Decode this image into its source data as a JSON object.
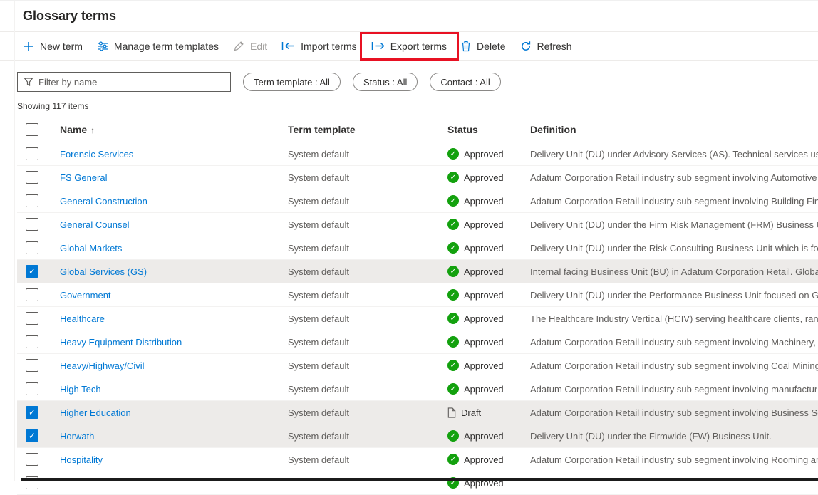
{
  "page": {
    "title": "Glossary terms"
  },
  "toolbar": {
    "items": [
      {
        "label": "New term",
        "icon": "plus-icon",
        "disabled": false,
        "highlighted": false
      },
      {
        "label": "Manage term templates",
        "icon": "sliders-icon",
        "disabled": false,
        "highlighted": false
      },
      {
        "label": "Edit",
        "icon": "pencil-icon",
        "disabled": true,
        "highlighted": false
      },
      {
        "label": "Import terms",
        "icon": "import-arrow-icon",
        "disabled": false,
        "highlighted": false
      },
      {
        "label": "Export terms",
        "icon": "export-arrow-icon",
        "disabled": false,
        "highlighted": true
      },
      {
        "label": "Delete",
        "icon": "trash-icon",
        "disabled": false,
        "highlighted": false
      },
      {
        "label": "Refresh",
        "icon": "refresh-icon",
        "disabled": false,
        "highlighted": false
      }
    ]
  },
  "filters": {
    "search_placeholder": "Filter by name",
    "pills": [
      "Term template : All",
      "Status : All",
      "Contact : All"
    ]
  },
  "summary": "Showing 117 items",
  "table": {
    "columns": [
      "Name",
      "Term template",
      "Status",
      "Definition"
    ],
    "sort": {
      "column": "Name",
      "direction": "ascending"
    },
    "rows": [
      {
        "name": "Forensic Services",
        "template": "System default",
        "status": "Approved",
        "definition": "Delivery Unit (DU) under Advisory Services (AS). Technical services used",
        "checked": false
      },
      {
        "name": "FS General",
        "template": "System default",
        "status": "Approved",
        "definition": "Adatum Corporation Retail industry sub segment involving Automotive",
        "checked": false
      },
      {
        "name": "General Construction",
        "template": "System default",
        "status": "Approved",
        "definition": "Adatum Corporation Retail industry sub segment involving Building Fin",
        "checked": false
      },
      {
        "name": "General Counsel",
        "template": "System default",
        "status": "Approved",
        "definition": "Delivery Unit (DU) under the Firm Risk Management (FRM) Business Un",
        "checked": false
      },
      {
        "name": "Global Markets",
        "template": "System default",
        "status": "Approved",
        "definition": "Delivery Unit (DU) under the Risk Consulting Business Unit which is foc",
        "checked": false
      },
      {
        "name": "Global Services (GS)",
        "template": "System default",
        "status": "Approved",
        "definition": "Internal facing Business Unit (BU) in Adatum Corporation Retail. Global",
        "checked": true
      },
      {
        "name": "Government",
        "template": "System default",
        "status": "Approved",
        "definition": "Delivery Unit (DU) under the Performance Business Unit focused on Go",
        "checked": false
      },
      {
        "name": "Healthcare",
        "template": "System default",
        "status": "Approved",
        "definition": "The Healthcare Industry Vertical (HCIV) serving healthcare clients, rang",
        "checked": false
      },
      {
        "name": "Heavy Equipment Distribution",
        "template": "System default",
        "status": "Approved",
        "definition": "Adatum Corporation Retail industry sub segment involving Machinery,",
        "checked": false
      },
      {
        "name": "Heavy/Highway/Civil",
        "template": "System default",
        "status": "Approved",
        "definition": "Adatum Corporation Retail industry sub segment involving Coal Mining",
        "checked": false
      },
      {
        "name": "High Tech",
        "template": "System default",
        "status": "Approved",
        "definition": "Adatum Corporation Retail industry sub segment involving manufactur",
        "checked": false
      },
      {
        "name": "Higher Education",
        "template": "System default",
        "status": "Draft",
        "definition": "Adatum Corporation Retail industry sub segment involving Business Se",
        "checked": true
      },
      {
        "name": "Horwath",
        "template": "System default",
        "status": "Approved",
        "definition": "Delivery Unit (DU) under the Firmwide (FW) Business Unit.",
        "checked": true
      },
      {
        "name": "Hospitality",
        "template": "System default",
        "status": "Approved",
        "definition": "Adatum Corporation Retail industry sub segment involving Rooming an",
        "checked": false
      },
      {
        "name": "",
        "template": "",
        "status": "Approved",
        "definition": "",
        "checked": false,
        "partial": true
      }
    ]
  },
  "colors": {
    "accent_blue": "#0078d4",
    "approved_green": "#13a10e",
    "selected_row_bg": "#edebe9",
    "highlight_red": "#e81123",
    "disabled_grey": "#a19f9d"
  }
}
